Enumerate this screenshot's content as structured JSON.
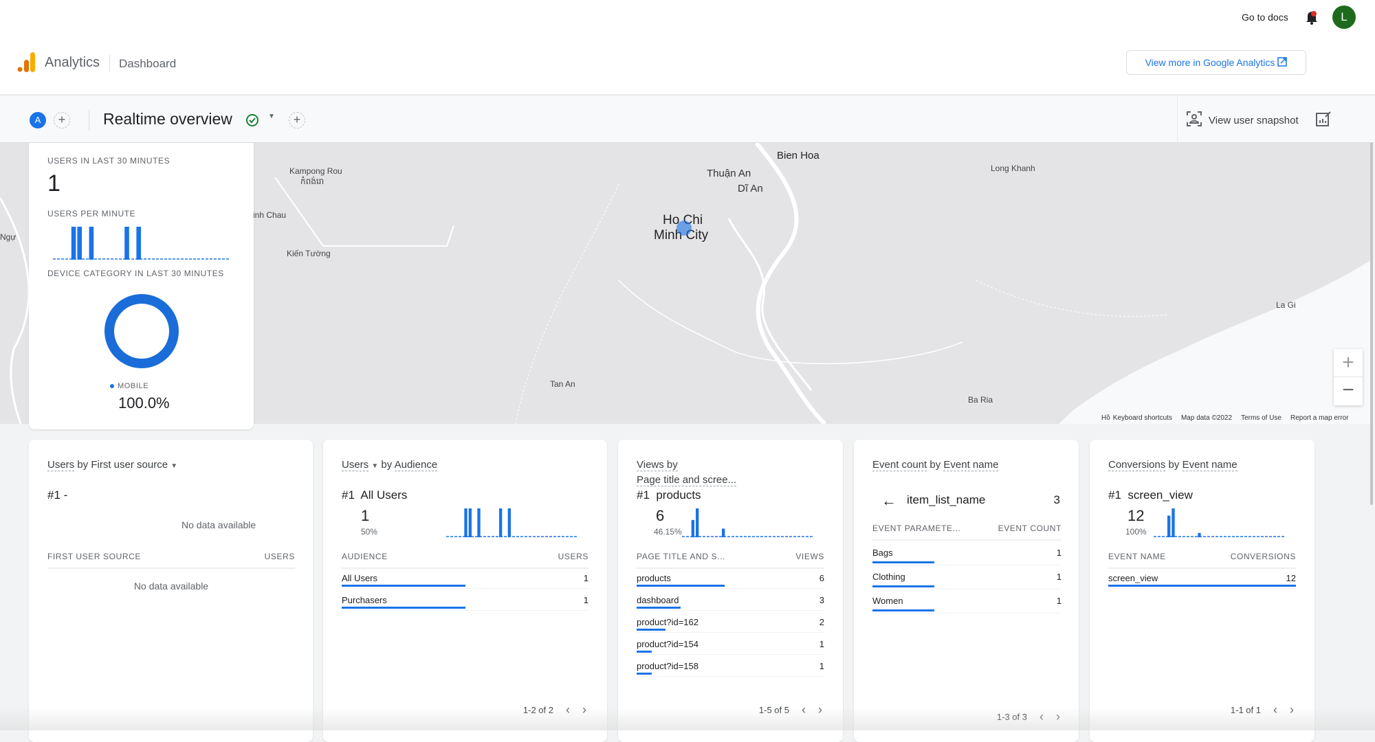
{
  "topbar": {
    "docs": "Go to docs",
    "avatar": "L",
    "brand": "Analytics",
    "section": "Dashboard",
    "view_more": "View more in Google Analytics"
  },
  "toolbar": {
    "audience_chip": "A",
    "title": "Realtime overview",
    "snapshot": "View user snapshot"
  },
  "colors": {
    "accent": "#1a73e8",
    "avatar": "#1e6b1e",
    "check": "#188038"
  },
  "map": {
    "labels": [
      "Kampong Rou",
      "កំពង់រោ",
      "Binh Chau",
      "Kiến Tường",
      "Thuận An",
      "Dĩ An",
      "Bien Hoa",
      "Ho Chi",
      "Minh City",
      "Long Khanh",
      "Tan An",
      "Ba Ria",
      "La Gi",
      "Ngự",
      "Hồ"
    ],
    "attribution": [
      "Keyboard shortcuts",
      "Map data ©2022",
      "Terms of Use",
      "Report a map error"
    ]
  },
  "summary": {
    "users_label": "USERS IN LAST 30 MINUTES",
    "users_value": "1",
    "per_minute_label": "USERS PER MINUTE",
    "per_minute": [
      0,
      0,
      0,
      1,
      1,
      0,
      1,
      0,
      0,
      0,
      0,
      0,
      1,
      0,
      1,
      0,
      0,
      0,
      0,
      0,
      0,
      0,
      0,
      0,
      0,
      0,
      0,
      0,
      0,
      0
    ],
    "device_label": "DEVICE CATEGORY IN LAST 30 MINUTES",
    "device_name": "MOBILE",
    "device_pct": "100.0%",
    "device_fraction": 1.0
  },
  "cards": {
    "source": {
      "title_a": "Users",
      "title_b": "by",
      "title_c": "First user source",
      "rank": "#1  -",
      "nodata_top": "No data available",
      "col1": "FIRST USER SOURCE",
      "col2": "USERS",
      "nodata": "No data available"
    },
    "audience": {
      "title_a": "Users",
      "title_b": "by",
      "title_c": "Audience",
      "rank": "#1  All Users",
      "value": "1",
      "pct": "50%",
      "spark": [
        0,
        0,
        0,
        0,
        1,
        1,
        0,
        1,
        0,
        0,
        0,
        0,
        1,
        0,
        1,
        0,
        0,
        0,
        0,
        0,
        0,
        0,
        0,
        0,
        0,
        0,
        0,
        0,
        0,
        0
      ],
      "col1": "AUDIENCE",
      "col2": "USERS",
      "rows": [
        {
          "name": "All Users",
          "value": "1",
          "frac": 1
        },
        {
          "name": "Purchasers",
          "value": "1",
          "frac": 1
        }
      ],
      "pager": "1-2 of 2"
    },
    "views": {
      "title_a": "Views by",
      "title_c": "Page title and scree...",
      "rank": "#1  products",
      "value": "6",
      "pct": "46.15%",
      "spark": [
        0,
        0,
        0.6,
        1,
        0,
        0,
        0,
        0,
        0,
        0.3,
        0,
        0,
        0,
        0,
        0,
        0,
        0,
        0,
        0,
        0,
        0,
        0,
        0,
        0,
        0,
        0,
        0,
        0,
        0,
        0
      ],
      "col1": "PAGE TITLE AND S...",
      "col2": "VIEWS",
      "rows": [
        {
          "name": "products",
          "value": "6",
          "frac": 1
        },
        {
          "name": "dashboard",
          "value": "3",
          "frac": 0.5
        },
        {
          "name": "product?id=162",
          "value": "2",
          "frac": 0.33
        },
        {
          "name": "product?id=154",
          "value": "1",
          "frac": 0.17
        },
        {
          "name": "product?id=158",
          "value": "1",
          "frac": 0.17
        }
      ],
      "pager": "1-5 of 5"
    },
    "events": {
      "title_a": "Event count",
      "title_b": "by",
      "title_c": "Event name",
      "param": "item_list_name",
      "param_count": "3",
      "col1": "EVENT PARAMETE...",
      "col2": "EVENT COUNT",
      "rows": [
        {
          "name": "Bags",
          "value": "1",
          "frac": 1
        },
        {
          "name": "Clothing",
          "value": "1",
          "frac": 1
        },
        {
          "name": "Women",
          "value": "1",
          "frac": 1
        }
      ],
      "pager": "1-3 of 3"
    },
    "conversions": {
      "title_a": "Conversions",
      "title_b": "by",
      "title_c": "Event name",
      "rank": "#1  screen_view",
      "value": "12",
      "pct": "100%",
      "spark": [
        0,
        0,
        0,
        0.75,
        1,
        0,
        0,
        0,
        0,
        0,
        0.15,
        0,
        0,
        0,
        0,
        0,
        0,
        0,
        0,
        0,
        0,
        0,
        0,
        0,
        0,
        0,
        0,
        0,
        0,
        0
      ],
      "col1": "EVENT NAME",
      "col2": "CONVERSIONS",
      "rows": [
        {
          "name": "screen_view",
          "value": "12",
          "frac": 1
        }
      ],
      "pager": "1-1 of 1"
    }
  }
}
